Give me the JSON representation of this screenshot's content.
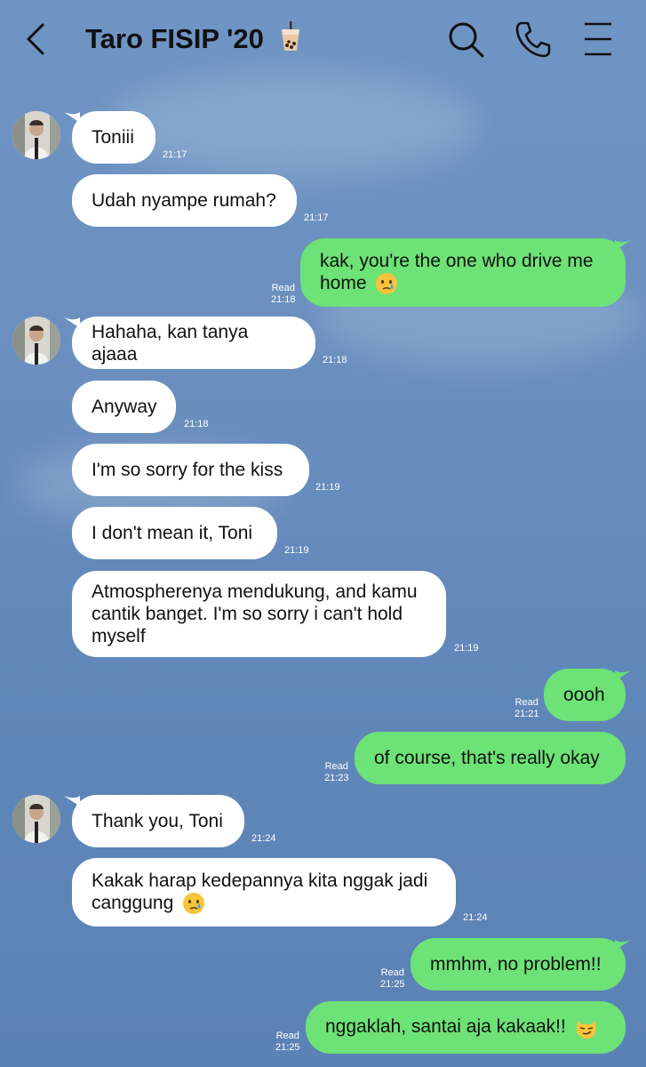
{
  "header": {
    "title": "Taro FISIP '20",
    "title_emoji": "bubble-tea-icon"
  },
  "messages": [
    {
      "dir": "in",
      "text": "Toniii",
      "time": "21:17"
    },
    {
      "dir": "in",
      "text": "Udah nyampe rumah?",
      "time": "21:17"
    },
    {
      "dir": "out",
      "text": "kak, you're the one who drive me home",
      "emoji": "crying-face-icon",
      "read": "Read",
      "time": "21:18"
    },
    {
      "dir": "in",
      "text": "Hahaha, kan tanya ajaaa",
      "time": "21:18"
    },
    {
      "dir": "in",
      "text": "Anyway",
      "time": "21:18"
    },
    {
      "dir": "in",
      "text": "I'm so sorry for the kiss",
      "time": "21:19"
    },
    {
      "dir": "in",
      "text": "I don't mean it, Toni",
      "time": "21:19"
    },
    {
      "dir": "in",
      "text": "Atmospherenya mendukung, and kamu cantik banget. I'm so sorry i can't hold myself",
      "time": "21:19"
    },
    {
      "dir": "out",
      "text": "oooh",
      "read": "Read",
      "time": "21:21"
    },
    {
      "dir": "out",
      "text": "of course, that's really okay",
      "read": "Read",
      "time": "21:23"
    },
    {
      "dir": "in",
      "text": "Thank you, Toni",
      "time": "21:24"
    },
    {
      "dir": "in",
      "text": "Kakak harap kedepannya kita nggak jadi canggung",
      "emoji": "crying-face-icon",
      "time": "21:24"
    },
    {
      "dir": "out",
      "text": "mmhm, no problem!!",
      "read": "Read",
      "time": "21:25"
    },
    {
      "dir": "out",
      "text": "nggaklah, santai aja kakaak!!",
      "emoji": "smirking-cat-icon",
      "read": "Read",
      "time": "21:25"
    }
  ],
  "colors": {
    "incoming_bubble": "#ffffff",
    "outgoing_bubble": "#6de276",
    "background": "#6a8fbf"
  }
}
